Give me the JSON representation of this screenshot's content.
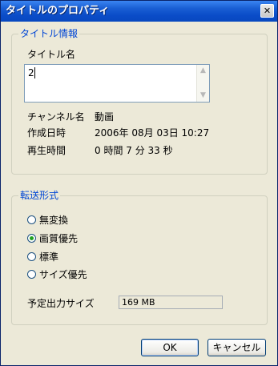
{
  "window": {
    "title": "タイトルのプロパティ",
    "close_glyph": "✕"
  },
  "title_group": {
    "legend": "タイトル情報",
    "name_label": "タイトル名",
    "name_value": "2",
    "info": [
      {
        "label": "チャンネル名",
        "value": "動画"
      },
      {
        "label": "作成日時",
        "value": "2006年 08月 03日 10:27"
      },
      {
        "label": "再生時間",
        "value": "0 時間 7 分 33 秒"
      }
    ]
  },
  "transfer_group": {
    "legend": "転送形式",
    "options": [
      {
        "label": "無変換",
        "checked": false
      },
      {
        "label": "画質優先",
        "checked": true
      },
      {
        "label": "標準",
        "checked": false
      },
      {
        "label": "サイズ優先",
        "checked": false
      }
    ],
    "estimated_size_label": "予定出力サイズ",
    "estimated_size_value": "169 MB"
  },
  "buttons": {
    "ok": "OK",
    "cancel": "キャンセル"
  }
}
